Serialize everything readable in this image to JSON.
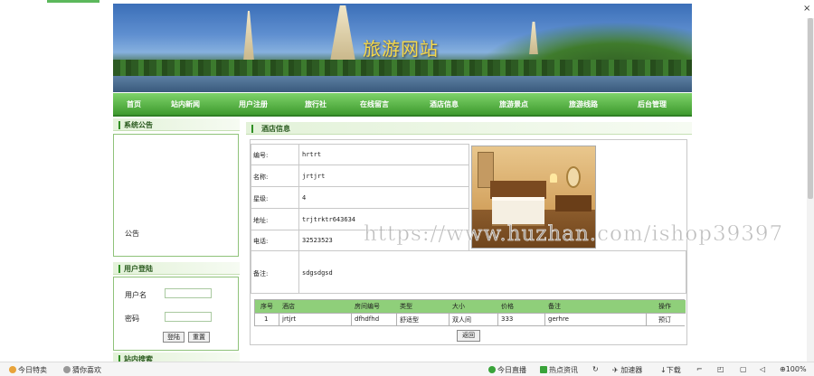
{
  "site": {
    "title": "旅游网站"
  },
  "nav": [
    "首页",
    "站内新闻",
    "用户注册",
    "旅行社",
    "在线留言",
    "酒店信息",
    "旅游景点",
    "旅游线路",
    "后台管理"
  ],
  "sidebar": {
    "announcement": {
      "title": "系统公告",
      "content": "公告"
    },
    "login": {
      "title": "用户登陆",
      "username_label": "用户名",
      "password_label": "密码",
      "login_button": "登陆",
      "reset_button": "重置"
    },
    "search": {
      "title": "站内搜索"
    }
  },
  "hotel": {
    "section_title": "酒店信息",
    "fields": [
      {
        "label": "编号:",
        "value": "hrtrt"
      },
      {
        "label": "名称:",
        "value": "jrtjrt"
      },
      {
        "label": "星级:",
        "value": "4"
      },
      {
        "label": "地址:",
        "value": "trjtrktr643634"
      },
      {
        "label": "电话:",
        "value": "32523523"
      },
      {
        "label": "备注:",
        "value": "sdgsdgsd"
      }
    ],
    "rooms": {
      "headers": [
        "序号",
        "酒店",
        "房间编号",
        "类型",
        "大小",
        "价格",
        "备注",
        "操作"
      ],
      "rows": [
        [
          "1",
          "jrtjrt",
          "dfhdfhd",
          "舒适型",
          "双人间",
          "333",
          "gerhre",
          "预订"
        ]
      ]
    },
    "back_button": "返回"
  },
  "watermark": "https://www.huzhan.com/ishop39397",
  "browser": {
    "close": "×",
    "status_left": [
      "今日特卖",
      "猜你喜欢"
    ],
    "status_right": [
      "今日直播",
      "热点资讯",
      "加速器",
      "下载",
      "100%"
    ]
  },
  "colors": {
    "nav_green": "#3e9a2e",
    "accent_green": "#2f8f24",
    "title_yellow": "#f5d84a"
  }
}
